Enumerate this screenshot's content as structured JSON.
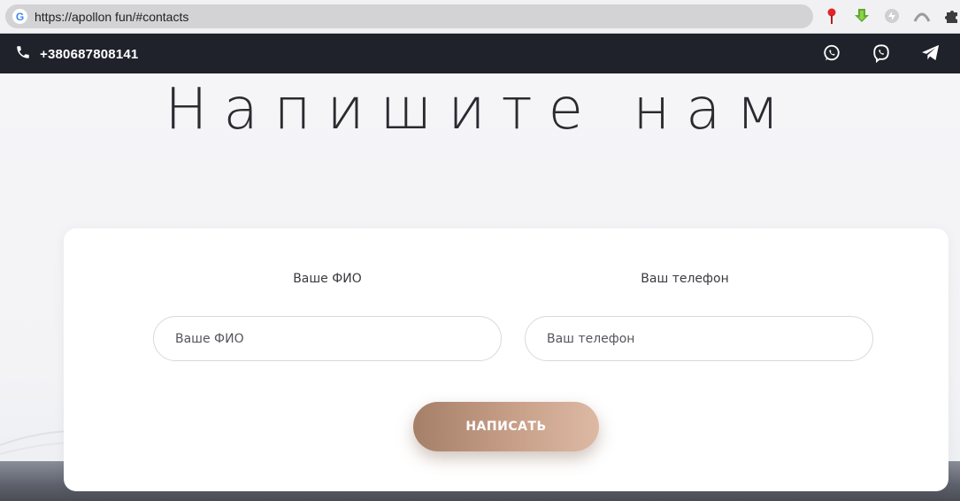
{
  "browser": {
    "url": "https://apollon fun/#contacts",
    "extension_icons": [
      "pin-icon",
      "download-icon",
      "sync-icon",
      "profile-icon",
      "puzzle-icon"
    ]
  },
  "topbar": {
    "phone": "+380687808141",
    "social_icons": [
      "whatsapp-icon",
      "viber-icon",
      "telegram-icon"
    ]
  },
  "page": {
    "title": "Напишите нам"
  },
  "form": {
    "name_label": "Ваше ФИО",
    "name_placeholder": "Ваше ФИО",
    "phone_label": "Ваш телефон",
    "phone_placeholder": "Ваш телефон",
    "submit_label": "НАПИСАТЬ"
  },
  "colors": {
    "topbar_bg": "#1f212b",
    "button_start": "#a67f68",
    "button_end": "#ddb9a3"
  }
}
